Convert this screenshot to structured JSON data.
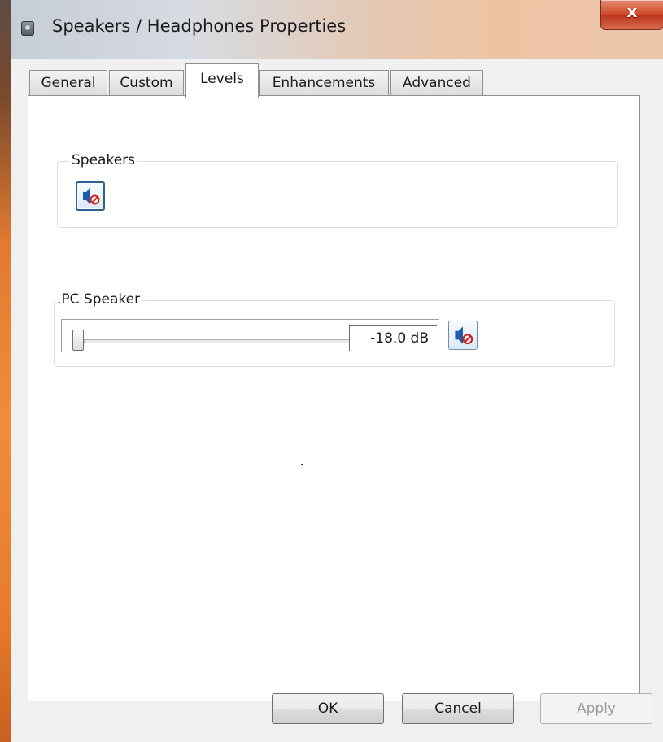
{
  "window": {
    "title": "Speakers / Headphones Properties",
    "close_symbol": "x"
  },
  "tabs": [
    {
      "label": "General",
      "active": false
    },
    {
      "label": "Custom",
      "active": false
    },
    {
      "label": "Levels",
      "active": true
    },
    {
      "label": "Enhancements",
      "active": false
    },
    {
      "label": "Advanced",
      "active": false
    }
  ],
  "levels": {
    "speakers_group": {
      "label": "Speakers",
      "mute_icon": "speaker-muted-icon"
    },
    "pc_speaker_group": {
      "label": ".PC Speaker",
      "slider_level": 0,
      "level_text": "-18.0 dB",
      "mute_icon": "speaker-muted-icon"
    }
  },
  "buttons": {
    "ok": "OK",
    "cancel": "Cancel",
    "apply": "Apply"
  },
  "colors": {
    "accent_blue": "#2c628b",
    "mute_red": "#d0211a",
    "close_red": "#c8452a"
  }
}
